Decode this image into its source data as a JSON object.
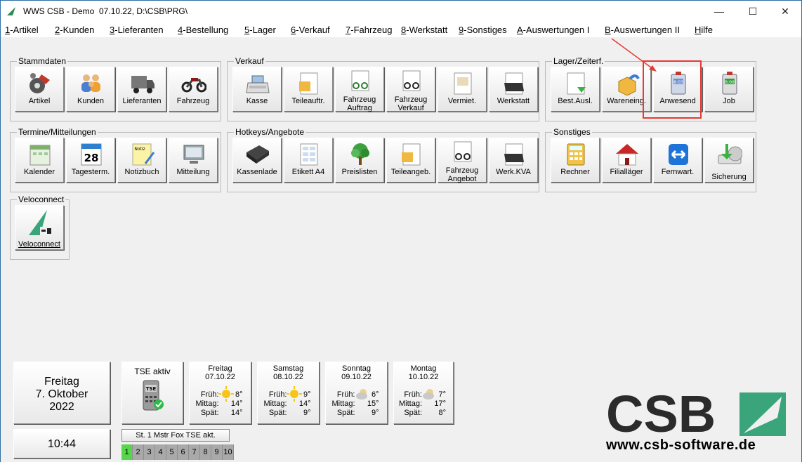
{
  "window": {
    "title": "WWS CSB - Demo  07.10.22, D:\\CSB\\PRG\\",
    "minimize": "—",
    "maximize": "☐",
    "close": "✕"
  },
  "menu": [
    {
      "hk": "1",
      "rest": "-Artikel"
    },
    {
      "hk": "2",
      "rest": "-Kunden"
    },
    {
      "hk": "3",
      "rest": "-Lieferanten"
    },
    {
      "hk": "4",
      "rest": "-Bestellung"
    },
    {
      "hk": "5",
      "rest": "-Lager"
    },
    {
      "hk": "6",
      "rest": "-Verkauf"
    },
    {
      "hk": "7",
      "rest": "-Fahrzeug"
    },
    {
      "hk": "8",
      "rest": "-Werkstatt"
    },
    {
      "hk": "9",
      "rest": "-Sonstiges"
    },
    {
      "hk": "A",
      "rest": "-Auswertungen I"
    },
    {
      "hk": "B",
      "rest": "-Auswertungen II"
    },
    {
      "hk": "H",
      "rest": "ilfe"
    }
  ],
  "groups": {
    "stammdaten": {
      "title": "Stammdaten",
      "tiles": [
        "Artikel",
        "Kunden",
        "Lieferanten",
        "Fahrzeug"
      ]
    },
    "verkauf": {
      "title": "Verkauf",
      "tiles": [
        "Kasse",
        "Teileauftr.",
        "Fahrzeug\nAuftrag",
        "Fahrzeug\nVerkauf",
        "Vermiet.",
        "Werkstatt"
      ]
    },
    "lager": {
      "title": "Lager/Zeiterf.",
      "tiles": [
        "Best.Ausl.",
        "Wareneing.",
        "Anwesend",
        "Job"
      ]
    },
    "termine": {
      "title": "Termine/Mitteilungen",
      "tiles": [
        "Kalender",
        "Tagesterm.",
        "Notizbuch",
        "Mitteilung"
      ]
    },
    "hotkeys": {
      "title": "Hotkeys/Angebote",
      "tiles": [
        "Kassenlade",
        "Etikett A4",
        "Preislisten",
        "Teileangeb.",
        "Fahrzeug\nAngebot",
        "Werk.KVA"
      ]
    },
    "sonstiges": {
      "title": "Sonstiges",
      "tiles": [
        "Rechner",
        "Filialläger",
        "Fernwart.",
        "Sicherung"
      ]
    },
    "veloconnect": {
      "title": "Veloconnect",
      "tiles": [
        "Veloconnect"
      ]
    }
  },
  "icons": {
    "calendar_day": "28",
    "notiz": "Notiz",
    "job_time": "8:00",
    "anwesend_time": "8:03"
  },
  "bottom": {
    "day": "Freitag",
    "date": "7. Oktober",
    "year": "2022",
    "time": "10:44",
    "tse": "TSE aktiv",
    "tse_icon_text": "TSE",
    "station": "St. 1 Mstr Fox TSE akt.",
    "numbers": [
      "1",
      "2",
      "3",
      "4",
      "5",
      "6",
      "7",
      "8",
      "9",
      "10"
    ],
    "active_number": "1"
  },
  "weather": [
    {
      "day": "Freitag",
      "date": "07.10.22",
      "frueh": "8°",
      "mittag": "14°",
      "spaet": "14°",
      "icon": "sun-icon"
    },
    {
      "day": "Samstag",
      "date": "08.10.22",
      "frueh": "9°",
      "mittag": "14°",
      "spaet": "9°",
      "icon": "sun-icon"
    },
    {
      "day": "Sonntag",
      "date": "09.10.22",
      "frueh": "6°",
      "mittag": "15°",
      "spaet": "9°",
      "icon": "cloud-sun-icon"
    },
    {
      "day": "Montag",
      "date": "10.10.22",
      "frueh": "7°",
      "mittag": "17°",
      "spaet": "8°",
      "icon": "cloud-sun-icon"
    }
  ],
  "weather_labels": {
    "frueh": "Früh:",
    "mittag": "Mittag:",
    "spaet": "Spät:"
  },
  "branding": {
    "logo_text": "CSB",
    "url": "www.csb-software.de",
    "accent": "#3aa57b",
    "highlight": "#e53935"
  }
}
